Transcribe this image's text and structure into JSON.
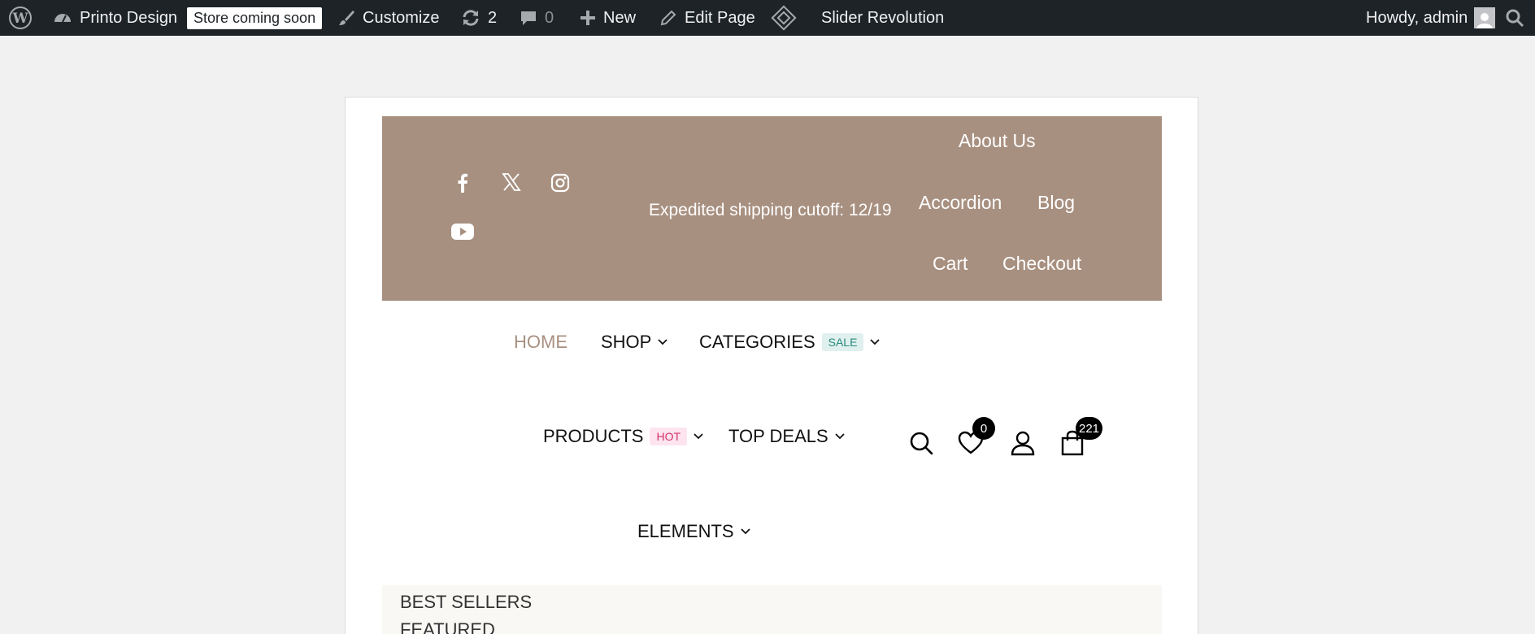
{
  "adminbar": {
    "site_name": "Printo Design",
    "store_badge": "Store coming soon",
    "customize": "Customize",
    "updates_count": "2",
    "comments_count": "0",
    "new_label": "New",
    "edit_page": "Edit Page",
    "slider_revolution": "Slider Revolution",
    "howdy": "Howdy, admin"
  },
  "topbar": {
    "shipping_notice": "Expedited shipping cutoff: 12/19",
    "links": {
      "about_us": "About Us",
      "accordion": "Accordion",
      "blog": "Blog",
      "cart": "Cart",
      "checkout": "Checkout"
    },
    "bg_color": "#a89080"
  },
  "nav": {
    "home": "HOME",
    "shop": "SHOP",
    "categories": "CATEGORIES",
    "sale_tag": "SALE",
    "products": "PRODUCTS",
    "hot_tag": "HOT",
    "top_deals": "TOP DEALS",
    "elements": "ELEMENTS",
    "wishlist_count": "0",
    "cart_count": "221"
  },
  "sublist": {
    "best_sellers": "BEST SELLERS",
    "featured": "FEATURED"
  }
}
